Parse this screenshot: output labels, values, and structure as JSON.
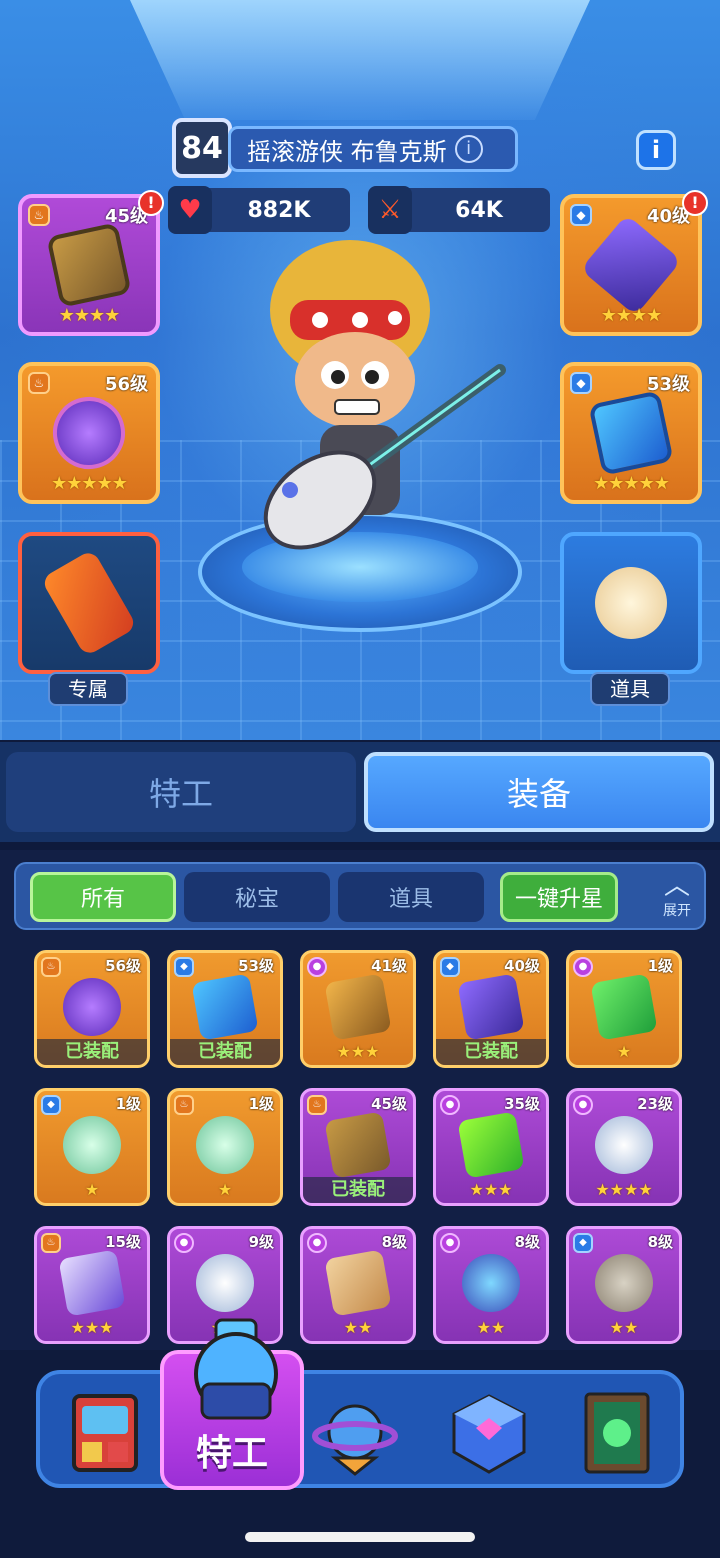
{
  "header": {
    "hero_level": "84",
    "hero_name": "摇滚游侠 布鲁克斯",
    "hp_value": "882K",
    "attack_value": "64K"
  },
  "colors": {
    "gold_star": "#ffd23a",
    "equipped_text": "#9af07a",
    "active_filter": "#57c447",
    "active_nav": "#b93ee2"
  },
  "left_slots": [
    {
      "level": "45级",
      "stars": "★★★★",
      "alert": "!"
    },
    {
      "level": "56级",
      "stars": "★★★★★"
    },
    {
      "label": "专属"
    }
  ],
  "right_slots": [
    {
      "level": "40级",
      "stars": "★★★★",
      "alert": "!"
    },
    {
      "level": "53级",
      "stars": "★★★★★"
    },
    {
      "label": "道具"
    }
  ],
  "tabs": {
    "agent": "特工",
    "equipment": "装备"
  },
  "filters": {
    "all": "所有",
    "treasure": "秘宝",
    "props": "道具",
    "upgrade_all": "一键升星",
    "expand": "展开"
  },
  "inventory": [
    {
      "level": "56级",
      "stars": "",
      "equipped": "已装配"
    },
    {
      "level": "53级",
      "stars": "",
      "equipped": "已装配"
    },
    {
      "level": "41级",
      "stars": "★★★",
      "equipped": ""
    },
    {
      "level": "40级",
      "stars": "",
      "equipped": "已装配"
    },
    {
      "level": "1级",
      "stars": "★",
      "equipped": ""
    },
    {
      "level": "1级",
      "stars": "★",
      "equipped": ""
    },
    {
      "level": "1级",
      "stars": "★",
      "equipped": ""
    },
    {
      "level": "45级",
      "stars": "",
      "equipped": "已装配"
    },
    {
      "level": "35级",
      "stars": "★★★",
      "equipped": ""
    },
    {
      "level": "23级",
      "stars": "★★★★",
      "equipped": ""
    },
    {
      "level": "15级",
      "stars": "★★★",
      "equipped": ""
    },
    {
      "level": "9级",
      "stars": "★★",
      "equipped": ""
    },
    {
      "level": "8级",
      "stars": "★★",
      "equipped": ""
    },
    {
      "level": "8级",
      "stars": "★★",
      "equipped": ""
    },
    {
      "level": "8级",
      "stars": "★★",
      "equipped": ""
    }
  ],
  "nav": {
    "active_label": "特工"
  }
}
